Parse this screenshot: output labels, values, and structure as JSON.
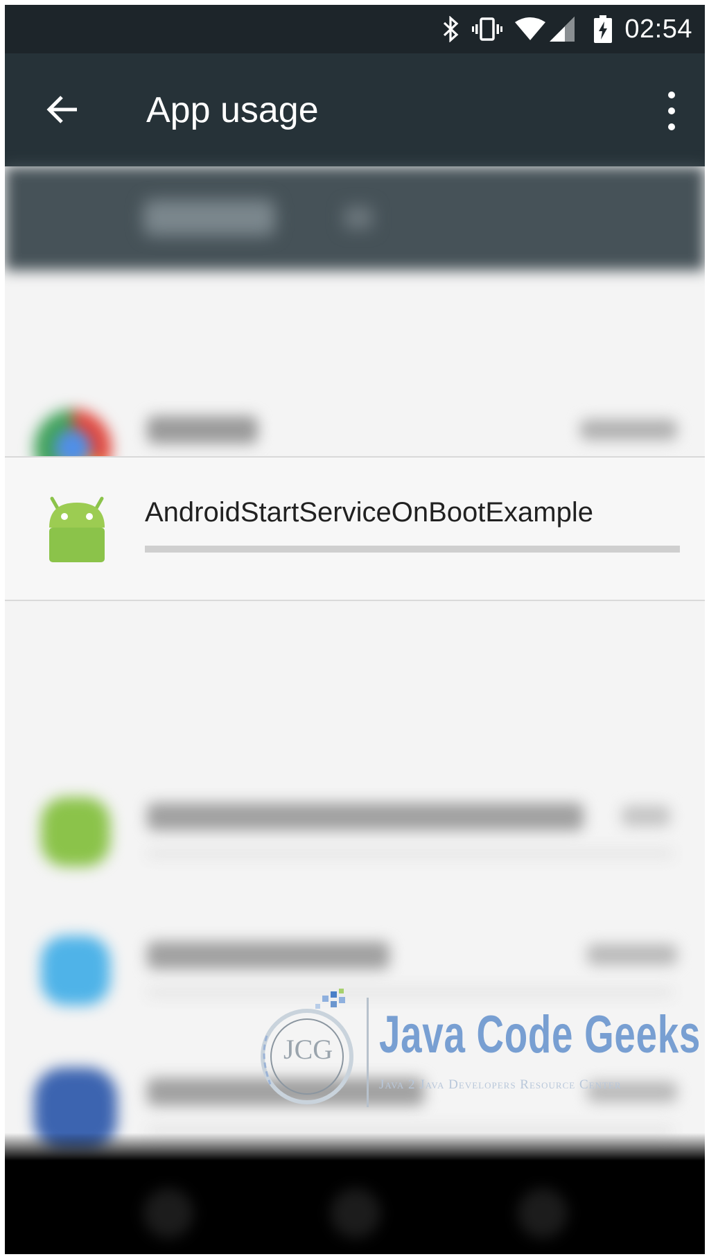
{
  "status_bar": {
    "time": "02:54",
    "icons": [
      "bluetooth-icon",
      "vibrate-icon",
      "wifi-icon",
      "signal-icon",
      "battery-charging-icon"
    ]
  },
  "toolbar": {
    "title": "App usage",
    "back_icon": "arrow-back-icon",
    "overflow_icon": "more-vert-icon"
  },
  "focused_app": {
    "name": "AndroidStartServiceOnBootExample",
    "icon": "android-icon",
    "usage_fraction": 1.0
  },
  "blurred_apps": [
    {
      "icon_color": "#e0483e"
    },
    {
      "icon_color": "#8bc34a"
    },
    {
      "icon_color": "#4fb3e8"
    },
    {
      "icon_color": "#3c64b0"
    },
    {
      "icon_color": "#7fa8a6"
    }
  ],
  "watermark": {
    "logo_letters": "JCG",
    "brand": "Java Code Geeks",
    "tagline": "Java 2 Java Developers Resource Center"
  },
  "colors": {
    "status_bar": "#1d252a",
    "toolbar": "#263238",
    "android_green": "#8bc34a"
  }
}
